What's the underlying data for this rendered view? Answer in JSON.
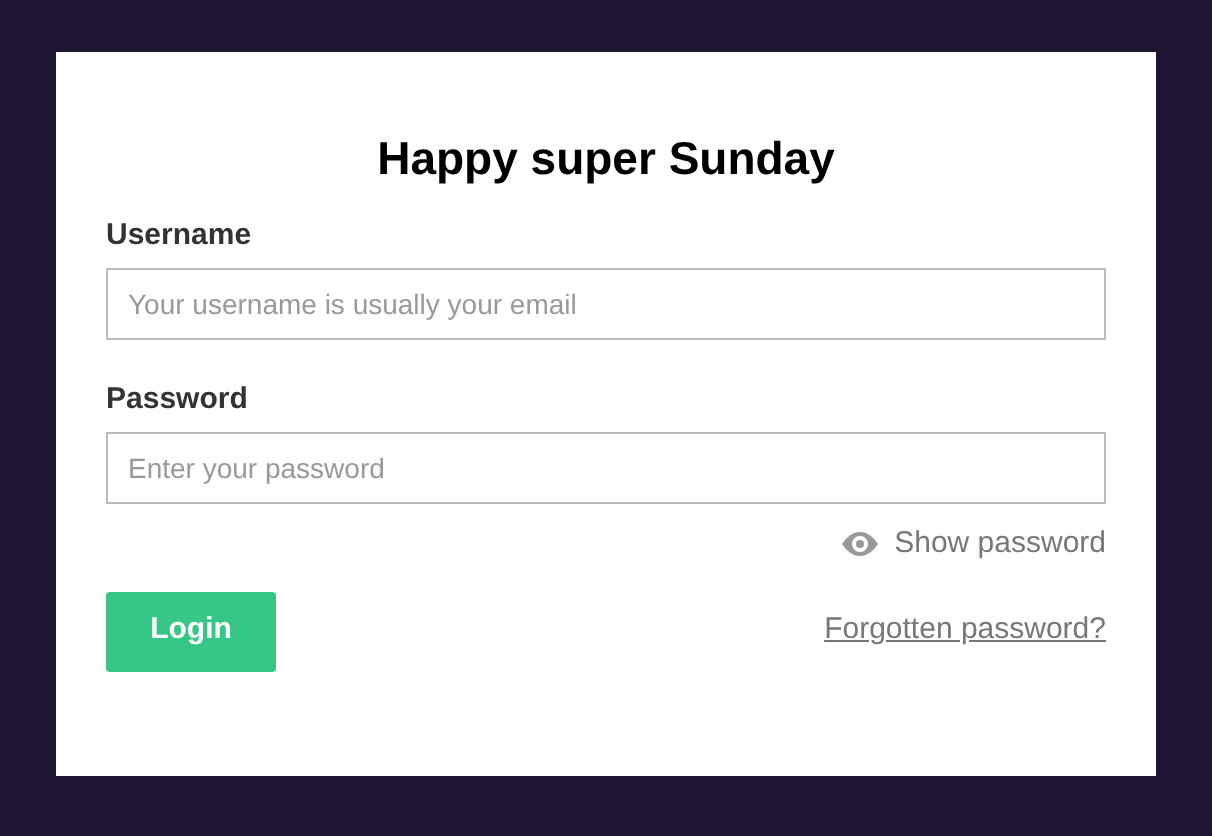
{
  "title": "Happy super Sunday",
  "username": {
    "label": "Username",
    "placeholder": "Your username is usually your email"
  },
  "password": {
    "label": "Password",
    "placeholder": "Enter your password"
  },
  "show_password": {
    "label": "Show password"
  },
  "login_button": "Login",
  "forgotten_link": "Forgotten password?"
}
